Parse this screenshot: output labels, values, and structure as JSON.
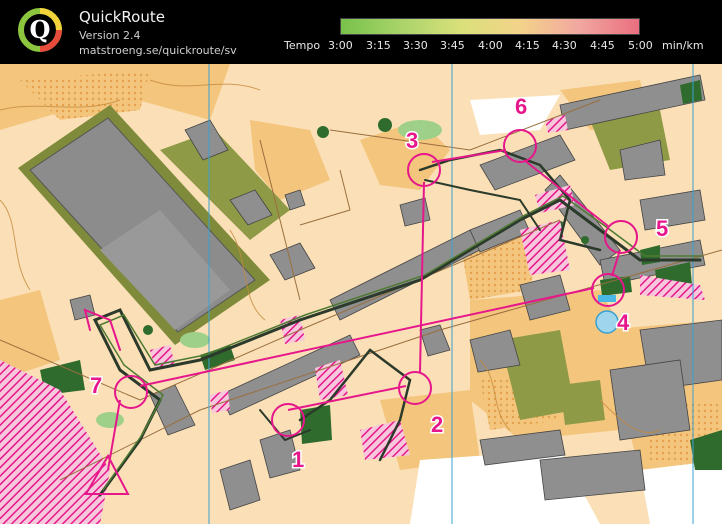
{
  "app": {
    "name": "QuickRoute",
    "version": "Version 2.4",
    "url": "matstroeng.se/quickroute/sv",
    "logo_letter": "Q"
  },
  "legend": {
    "prefix": "Tempo",
    "ticks": [
      "3:00",
      "3:15",
      "3:30",
      "3:45",
      "4:00",
      "4:15",
      "4:30",
      "4:45",
      "5:00"
    ],
    "unit": "min/km",
    "gradient_colors": [
      "#78c24a",
      "#a9d36a",
      "#d9e07a",
      "#f3d38a",
      "#f1a7a0",
      "#ea6f7f"
    ]
  },
  "map": {
    "controls": [
      "1",
      "2",
      "3",
      "4",
      "5",
      "6",
      "7"
    ],
    "colors": {
      "open_land": "#fbe0b7",
      "rough_open": "#f4c57d",
      "buildings": "#8f8f8f",
      "green_vegetation": "#8f9a46",
      "forest_green": "#2e6b2c",
      "course_magenta": "#e6168b",
      "route_line": "#2b3a2a",
      "contours": "#c68a3c"
    }
  }
}
